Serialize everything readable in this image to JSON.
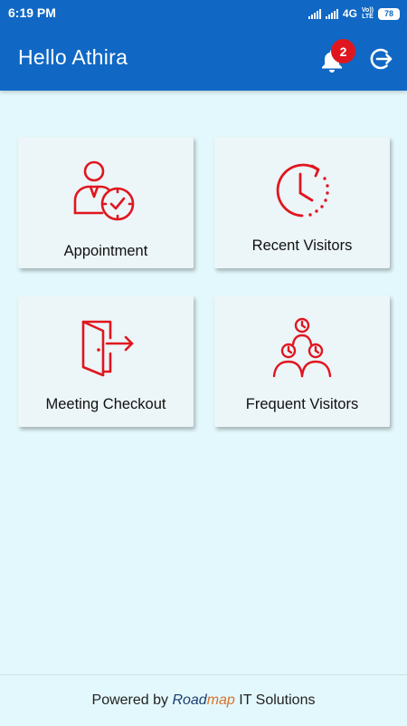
{
  "status_bar": {
    "time": "6:19 PM",
    "network": "4G",
    "volte_top": "Vo))",
    "volte_bottom": "LTE",
    "battery": "78"
  },
  "header": {
    "greeting": "Hello Athira",
    "notification_count": "2"
  },
  "tiles": [
    {
      "label": "Appointment",
      "icon": "person-clock-icon"
    },
    {
      "label": "Recent Visitors",
      "icon": "clock-history-icon"
    },
    {
      "label": "Meeting Checkout",
      "icon": "door-exit-icon"
    },
    {
      "label": "Frequent Visitors",
      "icon": "people-group-icon"
    }
  ],
  "footer": {
    "prefix": "Powered by ",
    "brand_part1": "Road",
    "brand_part2": "map",
    "suffix": " IT Solutions"
  },
  "colors": {
    "app_bar": "#1068c4",
    "background": "#e3f8fc",
    "icon_red": "#e0161f",
    "card": "#ecf5f8"
  }
}
